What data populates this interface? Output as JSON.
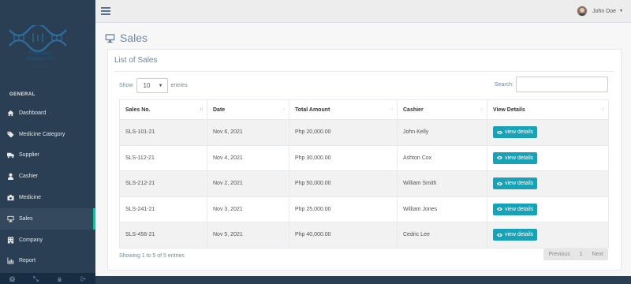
{
  "app": {
    "logo_line1": "Pharmacy",
    "logo_line2": "Management",
    "logo_sub": "SYSTEM"
  },
  "sidebar": {
    "section_title": "GENERAL",
    "items": [
      {
        "label": "Dashboard",
        "icon": "home-icon"
      },
      {
        "label": "Medicine Category",
        "icon": "tags-icon"
      },
      {
        "label": "Supplier",
        "icon": "truck-icon"
      },
      {
        "label": "Cashier",
        "icon": "user-icon"
      },
      {
        "label": "Medicine",
        "icon": "medkit-icon"
      },
      {
        "label": "Sales",
        "icon": "desktop-icon",
        "active": true
      },
      {
        "label": "Company",
        "icon": "building-icon"
      },
      {
        "label": "Report",
        "icon": "chart-icon"
      }
    ],
    "footer": [
      "settings-icon",
      "fullscreen-icon",
      "lock-icon",
      "logout-icon"
    ]
  },
  "topnav": {
    "user_name": "John Doe"
  },
  "page": {
    "title": "Sales",
    "panel_title": "List of Sales"
  },
  "table_controls": {
    "show_label": "Show",
    "entries_value": "10",
    "entries_label": "entries",
    "search_label": "Search:"
  },
  "table": {
    "columns": [
      "Sales No.",
      "Date",
      "Total Amount",
      "Cashier",
      "View Details"
    ],
    "button_label": "view details",
    "rows": [
      {
        "sales_no": "SLS-101-21",
        "date": "Nov 6, 2021",
        "amount": "Php 20,000.00",
        "cashier": "John Kelly"
      },
      {
        "sales_no": "SLS-112-21",
        "date": "Nov 4, 2021",
        "amount": "Php 30,000.00",
        "cashier": "Ashton Cox"
      },
      {
        "sales_no": "SLS-212-21",
        "date": "Nov 2, 2021",
        "amount": "Php 50,000.00",
        "cashier": "William Smith"
      },
      {
        "sales_no": "SLS-241-21",
        "date": "Nov 3, 2021",
        "amount": "Php 25,000.00",
        "cashier": "William Jones"
      },
      {
        "sales_no": "SLS-456-21",
        "date": "Nov 5, 2021",
        "amount": "Php 40,000.00",
        "cashier": "Cedric Lee"
      }
    ]
  },
  "footer_info": {
    "showing": "Showing 1 to 5 of 5 entries",
    "previous": "Previous",
    "page": "1",
    "next": "Next"
  }
}
